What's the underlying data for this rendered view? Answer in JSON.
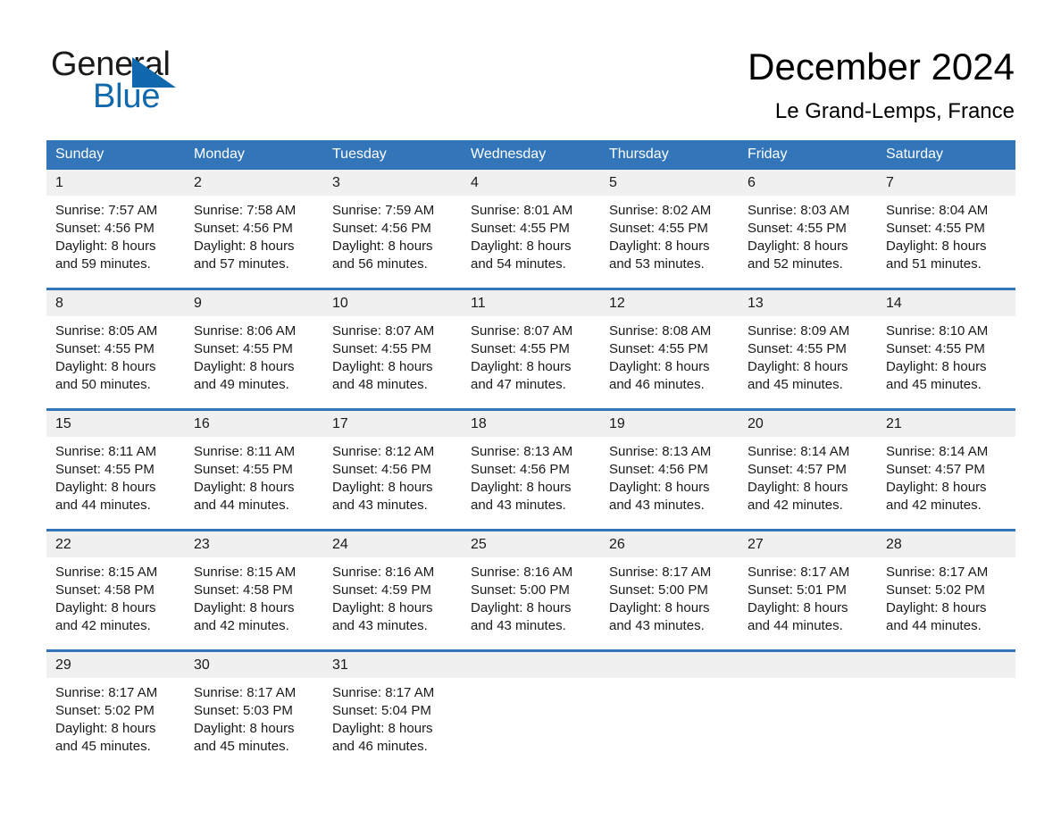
{
  "brand": {
    "line1": "General",
    "line2": "Blue",
    "logo_accent_color": "#1169ad",
    "triangle_icon": "triangle-icon"
  },
  "header": {
    "title": "December 2024",
    "location": "Le Grand-Lemps, France"
  },
  "theme": {
    "header_blue": "#3275b8",
    "date_band_gray": "#f0f0f0",
    "text_color": "#1a1a1a"
  },
  "weekdays": [
    "Sunday",
    "Monday",
    "Tuesday",
    "Wednesday",
    "Thursday",
    "Friday",
    "Saturday"
  ],
  "weeks": [
    [
      {
        "day": "1",
        "sunrise": "Sunrise: 7:57 AM",
        "sunset": "Sunset: 4:56 PM",
        "daylight1": "Daylight: 8 hours",
        "daylight2": "and 59 minutes."
      },
      {
        "day": "2",
        "sunrise": "Sunrise: 7:58 AM",
        "sunset": "Sunset: 4:56 PM",
        "daylight1": "Daylight: 8 hours",
        "daylight2": "and 57 minutes."
      },
      {
        "day": "3",
        "sunrise": "Sunrise: 7:59 AM",
        "sunset": "Sunset: 4:56 PM",
        "daylight1": "Daylight: 8 hours",
        "daylight2": "and 56 minutes."
      },
      {
        "day": "4",
        "sunrise": "Sunrise: 8:01 AM",
        "sunset": "Sunset: 4:55 PM",
        "daylight1": "Daylight: 8 hours",
        "daylight2": "and 54 minutes."
      },
      {
        "day": "5",
        "sunrise": "Sunrise: 8:02 AM",
        "sunset": "Sunset: 4:55 PM",
        "daylight1": "Daylight: 8 hours",
        "daylight2": "and 53 minutes."
      },
      {
        "day": "6",
        "sunrise": "Sunrise: 8:03 AM",
        "sunset": "Sunset: 4:55 PM",
        "daylight1": "Daylight: 8 hours",
        "daylight2": "and 52 minutes."
      },
      {
        "day": "7",
        "sunrise": "Sunrise: 8:04 AM",
        "sunset": "Sunset: 4:55 PM",
        "daylight1": "Daylight: 8 hours",
        "daylight2": "and 51 minutes."
      }
    ],
    [
      {
        "day": "8",
        "sunrise": "Sunrise: 8:05 AM",
        "sunset": "Sunset: 4:55 PM",
        "daylight1": "Daylight: 8 hours",
        "daylight2": "and 50 minutes."
      },
      {
        "day": "9",
        "sunrise": "Sunrise: 8:06 AM",
        "sunset": "Sunset: 4:55 PM",
        "daylight1": "Daylight: 8 hours",
        "daylight2": "and 49 minutes."
      },
      {
        "day": "10",
        "sunrise": "Sunrise: 8:07 AM",
        "sunset": "Sunset: 4:55 PM",
        "daylight1": "Daylight: 8 hours",
        "daylight2": "and 48 minutes."
      },
      {
        "day": "11",
        "sunrise": "Sunrise: 8:07 AM",
        "sunset": "Sunset: 4:55 PM",
        "daylight1": "Daylight: 8 hours",
        "daylight2": "and 47 minutes."
      },
      {
        "day": "12",
        "sunrise": "Sunrise: 8:08 AM",
        "sunset": "Sunset: 4:55 PM",
        "daylight1": "Daylight: 8 hours",
        "daylight2": "and 46 minutes."
      },
      {
        "day": "13",
        "sunrise": "Sunrise: 8:09 AM",
        "sunset": "Sunset: 4:55 PM",
        "daylight1": "Daylight: 8 hours",
        "daylight2": "and 45 minutes."
      },
      {
        "day": "14",
        "sunrise": "Sunrise: 8:10 AM",
        "sunset": "Sunset: 4:55 PM",
        "daylight1": "Daylight: 8 hours",
        "daylight2": "and 45 minutes."
      }
    ],
    [
      {
        "day": "15",
        "sunrise": "Sunrise: 8:11 AM",
        "sunset": "Sunset: 4:55 PM",
        "daylight1": "Daylight: 8 hours",
        "daylight2": "and 44 minutes."
      },
      {
        "day": "16",
        "sunrise": "Sunrise: 8:11 AM",
        "sunset": "Sunset: 4:55 PM",
        "daylight1": "Daylight: 8 hours",
        "daylight2": "and 44 minutes."
      },
      {
        "day": "17",
        "sunrise": "Sunrise: 8:12 AM",
        "sunset": "Sunset: 4:56 PM",
        "daylight1": "Daylight: 8 hours",
        "daylight2": "and 43 minutes."
      },
      {
        "day": "18",
        "sunrise": "Sunrise: 8:13 AM",
        "sunset": "Sunset: 4:56 PM",
        "daylight1": "Daylight: 8 hours",
        "daylight2": "and 43 minutes."
      },
      {
        "day": "19",
        "sunrise": "Sunrise: 8:13 AM",
        "sunset": "Sunset: 4:56 PM",
        "daylight1": "Daylight: 8 hours",
        "daylight2": "and 43 minutes."
      },
      {
        "day": "20",
        "sunrise": "Sunrise: 8:14 AM",
        "sunset": "Sunset: 4:57 PM",
        "daylight1": "Daylight: 8 hours",
        "daylight2": "and 42 minutes."
      },
      {
        "day": "21",
        "sunrise": "Sunrise: 8:14 AM",
        "sunset": "Sunset: 4:57 PM",
        "daylight1": "Daylight: 8 hours",
        "daylight2": "and 42 minutes."
      }
    ],
    [
      {
        "day": "22",
        "sunrise": "Sunrise: 8:15 AM",
        "sunset": "Sunset: 4:58 PM",
        "daylight1": "Daylight: 8 hours",
        "daylight2": "and 42 minutes."
      },
      {
        "day": "23",
        "sunrise": "Sunrise: 8:15 AM",
        "sunset": "Sunset: 4:58 PM",
        "daylight1": "Daylight: 8 hours",
        "daylight2": "and 42 minutes."
      },
      {
        "day": "24",
        "sunrise": "Sunrise: 8:16 AM",
        "sunset": "Sunset: 4:59 PM",
        "daylight1": "Daylight: 8 hours",
        "daylight2": "and 43 minutes."
      },
      {
        "day": "25",
        "sunrise": "Sunrise: 8:16 AM",
        "sunset": "Sunset: 5:00 PM",
        "daylight1": "Daylight: 8 hours",
        "daylight2": "and 43 minutes."
      },
      {
        "day": "26",
        "sunrise": "Sunrise: 8:17 AM",
        "sunset": "Sunset: 5:00 PM",
        "daylight1": "Daylight: 8 hours",
        "daylight2": "and 43 minutes."
      },
      {
        "day": "27",
        "sunrise": "Sunrise: 8:17 AM",
        "sunset": "Sunset: 5:01 PM",
        "daylight1": "Daylight: 8 hours",
        "daylight2": "and 44 minutes."
      },
      {
        "day": "28",
        "sunrise": "Sunrise: 8:17 AM",
        "sunset": "Sunset: 5:02 PM",
        "daylight1": "Daylight: 8 hours",
        "daylight2": "and 44 minutes."
      }
    ],
    [
      {
        "day": "29",
        "sunrise": "Sunrise: 8:17 AM",
        "sunset": "Sunset: 5:02 PM",
        "daylight1": "Daylight: 8 hours",
        "daylight2": "and 45 minutes."
      },
      {
        "day": "30",
        "sunrise": "Sunrise: 8:17 AM",
        "sunset": "Sunset: 5:03 PM",
        "daylight1": "Daylight: 8 hours",
        "daylight2": "and 45 minutes."
      },
      {
        "day": "31",
        "sunrise": "Sunrise: 8:17 AM",
        "sunset": "Sunset: 5:04 PM",
        "daylight1": "Daylight: 8 hours",
        "daylight2": "and 46 minutes."
      },
      {
        "day": "",
        "sunrise": "",
        "sunset": "",
        "daylight1": "",
        "daylight2": ""
      },
      {
        "day": "",
        "sunrise": "",
        "sunset": "",
        "daylight1": "",
        "daylight2": ""
      },
      {
        "day": "",
        "sunrise": "",
        "sunset": "",
        "daylight1": "",
        "daylight2": ""
      },
      {
        "day": "",
        "sunrise": "",
        "sunset": "",
        "daylight1": "",
        "daylight2": ""
      }
    ]
  ]
}
